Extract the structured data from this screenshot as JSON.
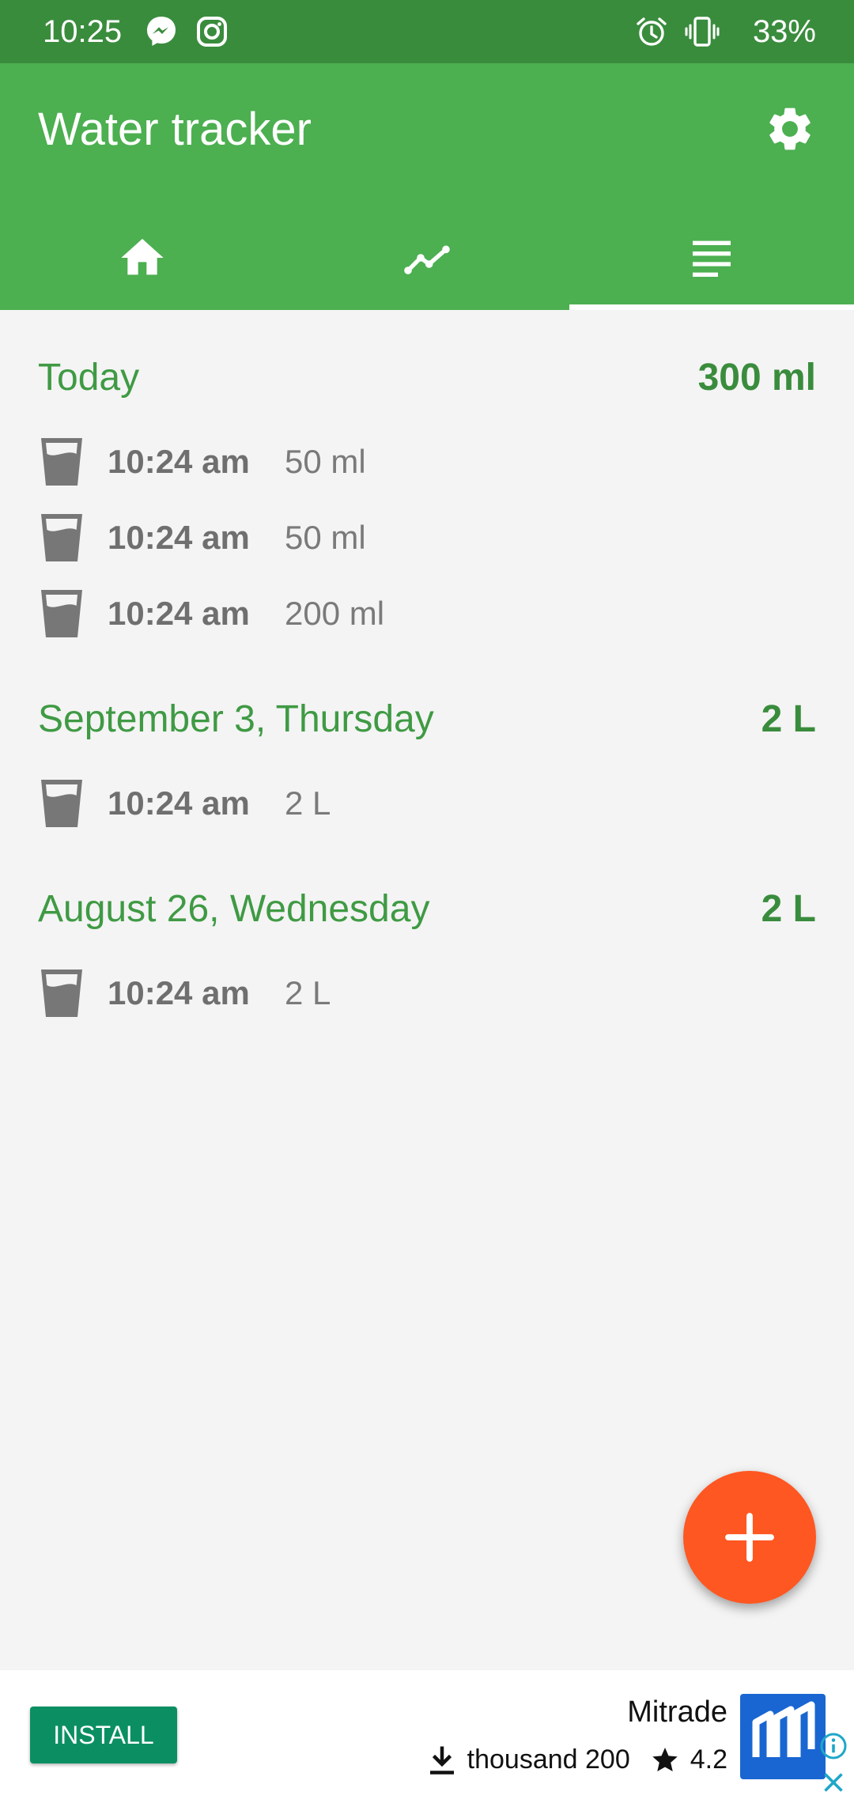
{
  "status_bar": {
    "time": "10:25",
    "battery": "33%",
    "icons": [
      "messenger-icon",
      "instagram-icon",
      "alarm-icon",
      "vibrate-icon"
    ]
  },
  "app_bar": {
    "title": "Water tracker",
    "settings_icon": "gear-icon",
    "tabs": [
      {
        "name": "home",
        "icon": "home-icon"
      },
      {
        "name": "statistics",
        "icon": "line-chart-icon"
      },
      {
        "name": "history",
        "icon": "list-icon",
        "selected": true
      }
    ]
  },
  "history": [
    {
      "date": "Today",
      "total": "300 ml",
      "entries": [
        {
          "time": "10:24 am",
          "amount": "50 ml"
        },
        {
          "time": "10:24 am",
          "amount": "50 ml"
        },
        {
          "time": "10:24 am",
          "amount": "200 ml"
        }
      ]
    },
    {
      "date": "September 3, Thursday",
      "total": "2 L",
      "entries": [
        {
          "time": "10:24 am",
          "amount": "2 L"
        }
      ]
    },
    {
      "date": "August 26, Wednesday",
      "total": "2 L",
      "entries": [
        {
          "time": "10:24 am",
          "amount": "2 L"
        }
      ]
    }
  ],
  "fab": {
    "icon": "plus-icon"
  },
  "ad": {
    "install_label": "INSTALL",
    "app_name": "Mitrade",
    "downloads": "thousand 200",
    "rating": "4.2"
  },
  "colors": {
    "status_bar": "#3a8c3d",
    "app_bar": "#4caf50",
    "accent_green": "#3f9a44",
    "fab": "#ff5722",
    "install_button": "#0b8f62"
  }
}
